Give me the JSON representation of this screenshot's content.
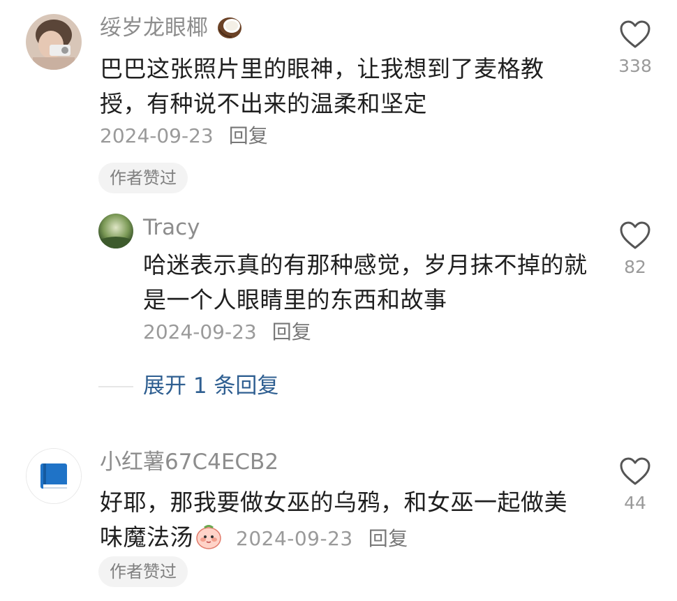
{
  "comments": [
    {
      "username": "绥岁龙眼椰",
      "username_emoji": "coconut-emoji",
      "text": "巴巴这张照片里的眼神，让我想到了麦格教授，有种说不出来的温柔和坚定",
      "date": "2024-09-23",
      "reply_label": "回复",
      "badge": "作者赞过",
      "likes": "338"
    },
    {
      "username": "Tracy",
      "text": "哈迷表示真的有那种感觉，岁月抹不掉的就是一个人眼睛里的东西和故事",
      "date": "2024-09-23",
      "reply_label": "回复",
      "likes": "82"
    },
    {
      "username": "小红薯67C4ECB2",
      "text": "好耶，那我要做女巫的乌鸦，和女巫一起做美味魔法汤",
      "text_emoji": "peach-face-emoji",
      "date": "2024-09-23",
      "reply_label": "回复",
      "badge": "作者赞过",
      "likes": "44"
    }
  ],
  "expand_replies": "展开 1 条回复",
  "colors": {
    "link": "#2f5f91",
    "muted": "#9a9a9a",
    "text": "#1f1f1f",
    "badge_bg": "#f3f3f3"
  }
}
